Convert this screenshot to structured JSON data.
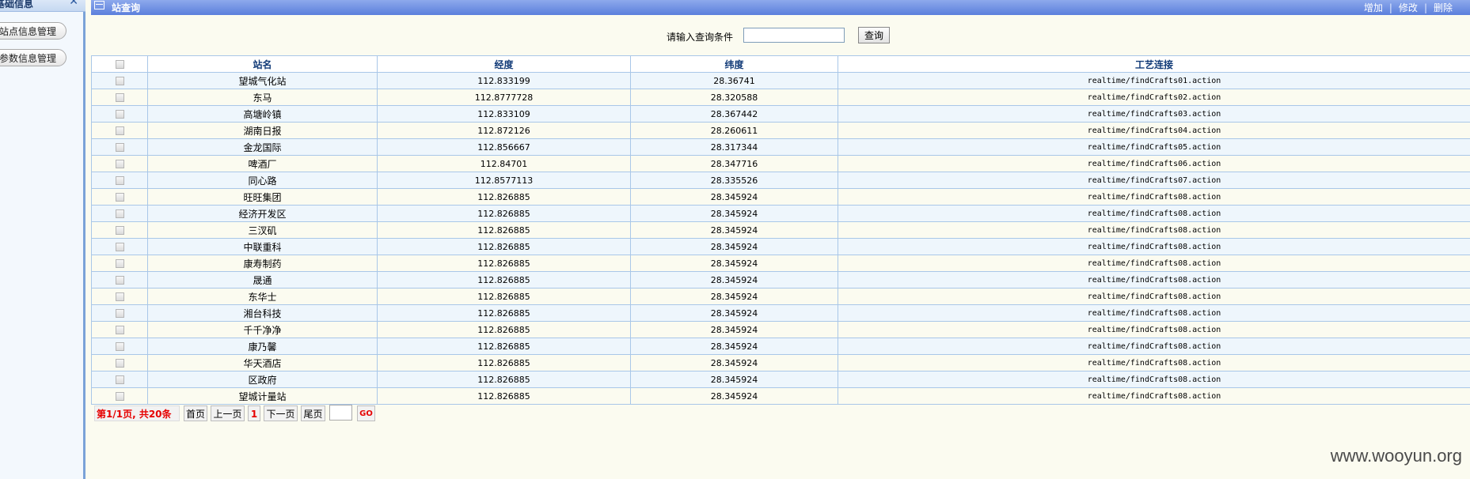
{
  "sidebar": {
    "title": "基础信息",
    "close_icon": "close-icon",
    "items": [
      {
        "label": "站点信息管理"
      },
      {
        "label": "参数信息管理"
      }
    ]
  },
  "panel": {
    "title": "站查询",
    "actions": {
      "add": "增加",
      "edit": "修改",
      "delete": "删除",
      "separator": "|"
    }
  },
  "search": {
    "label": "请输入查询条件",
    "value": "",
    "button": "查询"
  },
  "table": {
    "columns": [
      "站名",
      "经度",
      "纬度",
      "工艺连接"
    ],
    "rows": [
      {
        "name": "望城气化站",
        "lng": "112.833199",
        "lat": "28.36741",
        "link": "realtime/findCrafts01.action"
      },
      {
        "name": "东马",
        "lng": "112.8777728",
        "lat": "28.320588",
        "link": "realtime/findCrafts02.action"
      },
      {
        "name": "高塘岭镇",
        "lng": "112.833109",
        "lat": "28.367442",
        "link": "realtime/findCrafts03.action"
      },
      {
        "name": "湖南日报",
        "lng": "112.872126",
        "lat": "28.260611",
        "link": "realtime/findCrafts04.action"
      },
      {
        "name": "金龙国际",
        "lng": "112.856667",
        "lat": "28.317344",
        "link": "realtime/findCrafts05.action"
      },
      {
        "name": "啤酒厂",
        "lng": "112.84701",
        "lat": "28.347716",
        "link": "realtime/findCrafts06.action"
      },
      {
        "name": "同心路",
        "lng": "112.8577113",
        "lat": "28.335526",
        "link": "realtime/findCrafts07.action"
      },
      {
        "name": "旺旺集团",
        "lng": "112.826885",
        "lat": "28.345924",
        "link": "realtime/findCrafts08.action"
      },
      {
        "name": "经济开发区",
        "lng": "112.826885",
        "lat": "28.345924",
        "link": "realtime/findCrafts08.action"
      },
      {
        "name": "三汊矶",
        "lng": "112.826885",
        "lat": "28.345924",
        "link": "realtime/findCrafts08.action"
      },
      {
        "name": "中联重科",
        "lng": "112.826885",
        "lat": "28.345924",
        "link": "realtime/findCrafts08.action"
      },
      {
        "name": "康寿制药",
        "lng": "112.826885",
        "lat": "28.345924",
        "link": "realtime/findCrafts08.action"
      },
      {
        "name": "晟通",
        "lng": "112.826885",
        "lat": "28.345924",
        "link": "realtime/findCrafts08.action"
      },
      {
        "name": "东华士",
        "lng": "112.826885",
        "lat": "28.345924",
        "link": "realtime/findCrafts08.action"
      },
      {
        "name": "湘台科技",
        "lng": "112.826885",
        "lat": "28.345924",
        "link": "realtime/findCrafts08.action"
      },
      {
        "name": "千千净净",
        "lng": "112.826885",
        "lat": "28.345924",
        "link": "realtime/findCrafts08.action"
      },
      {
        "name": "康乃馨",
        "lng": "112.826885",
        "lat": "28.345924",
        "link": "realtime/findCrafts08.action"
      },
      {
        "name": "华天酒店",
        "lng": "112.826885",
        "lat": "28.345924",
        "link": "realtime/findCrafts08.action"
      },
      {
        "name": "区政府",
        "lng": "112.826885",
        "lat": "28.345924",
        "link": "realtime/findCrafts08.action"
      },
      {
        "name": "望城计量站",
        "lng": "112.826885",
        "lat": "28.345924",
        "link": "realtime/findCrafts08.action"
      }
    ]
  },
  "pager": {
    "summary": "第1/1页, 共20条",
    "first": "首页",
    "prev": "上一页",
    "current": "1",
    "next": "下一页",
    "last": "尾页",
    "go_value": "",
    "go": "GO"
  },
  "colors": {
    "titlebar": "#6b8de3",
    "header_text": "#123b78",
    "row_alt": "#eef6fc",
    "page_bg": "#fbfbf0",
    "pager_red": "#e60000"
  },
  "watermark": "www.wooyun.org"
}
